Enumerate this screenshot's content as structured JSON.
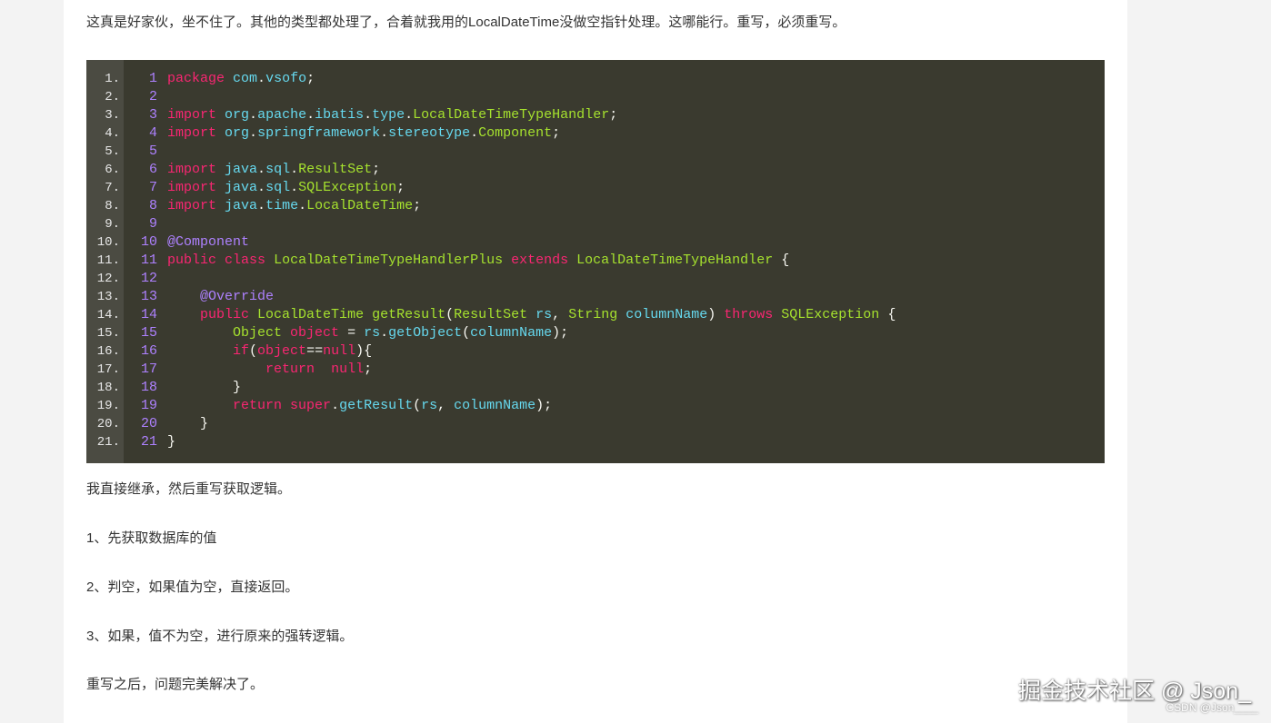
{
  "article": {
    "intro": "这真是好家伙，坐不住了。其他的类型都处理了，合着就我用的LocalDateTime没做空指针处理。这哪能行。重写，必须重写。",
    "after_code": "我直接继承，然后重写获取逻辑。",
    "step1": "1、先获取数据库的值",
    "step2": "2、判空，如果值为空，直接返回。",
    "step3": "3、如果，值不为空，进行原来的强转逻辑。",
    "conclusion": "重写之后，问题完美解决了。"
  },
  "code": {
    "gutter": [
      "1.",
      "2.",
      "3.",
      "4.",
      "5.",
      "6.",
      "7.",
      "8.",
      "9.",
      "10.",
      "11.",
      "12.",
      "13.",
      "14.",
      "15.",
      "16.",
      "17.",
      "18.",
      "19.",
      "20.",
      "21."
    ],
    "lines": [
      [
        {
          "t": "1",
          "c": "ln"
        },
        {
          "t": "package",
          "c": "kw"
        },
        {
          "t": " ",
          "c": "pl"
        },
        {
          "t": "com",
          "c": "pkg"
        },
        {
          "t": ".",
          "c": "pl"
        },
        {
          "t": "vsofo",
          "c": "pkg"
        },
        {
          "t": ";",
          "c": "pl"
        }
      ],
      [
        {
          "t": "2",
          "c": "ln"
        }
      ],
      [
        {
          "t": "3",
          "c": "ln"
        },
        {
          "t": "import",
          "c": "kw"
        },
        {
          "t": " ",
          "c": "pl"
        },
        {
          "t": "org",
          "c": "pkg"
        },
        {
          "t": ".",
          "c": "pl"
        },
        {
          "t": "apache",
          "c": "pkg"
        },
        {
          "t": ".",
          "c": "pl"
        },
        {
          "t": "ibatis",
          "c": "pkg"
        },
        {
          "t": ".",
          "c": "pl"
        },
        {
          "t": "type",
          "c": "pkg"
        },
        {
          "t": ".",
          "c": "pl"
        },
        {
          "t": "LocalDateTimeTypeHandler",
          "c": "cls"
        },
        {
          "t": ";",
          "c": "pl"
        }
      ],
      [
        {
          "t": "4",
          "c": "ln"
        },
        {
          "t": "import",
          "c": "kw"
        },
        {
          "t": " ",
          "c": "pl"
        },
        {
          "t": "org",
          "c": "pkg"
        },
        {
          "t": ".",
          "c": "pl"
        },
        {
          "t": "springframework",
          "c": "pkg"
        },
        {
          "t": ".",
          "c": "pl"
        },
        {
          "t": "stereotype",
          "c": "pkg"
        },
        {
          "t": ".",
          "c": "pl"
        },
        {
          "t": "Component",
          "c": "cls"
        },
        {
          "t": ";",
          "c": "pl"
        }
      ],
      [
        {
          "t": "5",
          "c": "ln"
        }
      ],
      [
        {
          "t": "6",
          "c": "ln"
        },
        {
          "t": "import",
          "c": "kw"
        },
        {
          "t": " ",
          "c": "pl"
        },
        {
          "t": "java",
          "c": "pkg"
        },
        {
          "t": ".",
          "c": "pl"
        },
        {
          "t": "sql",
          "c": "pkg"
        },
        {
          "t": ".",
          "c": "pl"
        },
        {
          "t": "ResultSet",
          "c": "cls"
        },
        {
          "t": ";",
          "c": "pl"
        }
      ],
      [
        {
          "t": "7",
          "c": "ln"
        },
        {
          "t": "import",
          "c": "kw"
        },
        {
          "t": " ",
          "c": "pl"
        },
        {
          "t": "java",
          "c": "pkg"
        },
        {
          "t": ".",
          "c": "pl"
        },
        {
          "t": "sql",
          "c": "pkg"
        },
        {
          "t": ".",
          "c": "pl"
        },
        {
          "t": "SQLException",
          "c": "cls"
        },
        {
          "t": ";",
          "c": "pl"
        }
      ],
      [
        {
          "t": "8",
          "c": "ln"
        },
        {
          "t": "import",
          "c": "kw"
        },
        {
          "t": " ",
          "c": "pl"
        },
        {
          "t": "java",
          "c": "pkg"
        },
        {
          "t": ".",
          "c": "pl"
        },
        {
          "t": "time",
          "c": "pkg"
        },
        {
          "t": ".",
          "c": "pl"
        },
        {
          "t": "LocalDateTime",
          "c": "cls"
        },
        {
          "t": ";",
          "c": "pl"
        }
      ],
      [
        {
          "t": "9",
          "c": "ln"
        }
      ],
      [
        {
          "t": "10",
          "c": "ln"
        },
        {
          "t": "@Component",
          "c": "ann"
        }
      ],
      [
        {
          "t": "11",
          "c": "ln"
        },
        {
          "t": "public",
          "c": "kw"
        },
        {
          "t": " ",
          "c": "pl"
        },
        {
          "t": "class",
          "c": "kw"
        },
        {
          "t": " ",
          "c": "pl"
        },
        {
          "t": "LocalDateTimeTypeHandlerPlus",
          "c": "cls"
        },
        {
          "t": " ",
          "c": "pl"
        },
        {
          "t": "extends",
          "c": "kw"
        },
        {
          "t": " ",
          "c": "pl"
        },
        {
          "t": "LocalDateTimeTypeHandler",
          "c": "cls"
        },
        {
          "t": " {",
          "c": "pl"
        }
      ],
      [
        {
          "t": "12",
          "c": "ln"
        }
      ],
      [
        {
          "t": "13",
          "c": "ln"
        },
        {
          "t": "    ",
          "c": "pl"
        },
        {
          "t": "@Override",
          "c": "ann"
        }
      ],
      [
        {
          "t": "14",
          "c": "ln"
        },
        {
          "t": "    ",
          "c": "pl"
        },
        {
          "t": "public",
          "c": "kw"
        },
        {
          "t": " ",
          "c": "pl"
        },
        {
          "t": "LocalDateTime",
          "c": "cls"
        },
        {
          "t": " ",
          "c": "pl"
        },
        {
          "t": "getResult",
          "c": "cls"
        },
        {
          "t": "(",
          "c": "pl"
        },
        {
          "t": "ResultSet",
          "c": "cls"
        },
        {
          "t": " ",
          "c": "pl"
        },
        {
          "t": "rs",
          "c": "pkg"
        },
        {
          "t": ", ",
          "c": "pl"
        },
        {
          "t": "String",
          "c": "cls"
        },
        {
          "t": " ",
          "c": "pl"
        },
        {
          "t": "columnName",
          "c": "pkg"
        },
        {
          "t": ") ",
          "c": "pl"
        },
        {
          "t": "throws",
          "c": "kw"
        },
        {
          "t": " ",
          "c": "pl"
        },
        {
          "t": "SQLException",
          "c": "cls"
        },
        {
          "t": " {",
          "c": "pl"
        }
      ],
      [
        {
          "t": "15",
          "c": "ln"
        },
        {
          "t": "        ",
          "c": "pl"
        },
        {
          "t": "Object",
          "c": "cls"
        },
        {
          "t": " ",
          "c": "pl"
        },
        {
          "t": "object",
          "c": "kw"
        },
        {
          "t": " = ",
          "c": "pl"
        },
        {
          "t": "rs",
          "c": "pkg"
        },
        {
          "t": ".",
          "c": "pl"
        },
        {
          "t": "getObject",
          "c": "pkg"
        },
        {
          "t": "(",
          "c": "pl"
        },
        {
          "t": "columnName",
          "c": "pkg"
        },
        {
          "t": ");",
          "c": "pl"
        }
      ],
      [
        {
          "t": "16",
          "c": "ln"
        },
        {
          "t": "        ",
          "c": "pl"
        },
        {
          "t": "if",
          "c": "kw"
        },
        {
          "t": "(",
          "c": "pl"
        },
        {
          "t": "object",
          "c": "kw"
        },
        {
          "t": "==",
          "c": "pl"
        },
        {
          "t": "null",
          "c": "kw"
        },
        {
          "t": "){",
          "c": "pl"
        }
      ],
      [
        {
          "t": "17",
          "c": "ln"
        },
        {
          "t": "            ",
          "c": "pl"
        },
        {
          "t": "return",
          "c": "kw"
        },
        {
          "t": "  ",
          "c": "pl"
        },
        {
          "t": "null",
          "c": "kw"
        },
        {
          "t": ";",
          "c": "pl"
        }
      ],
      [
        {
          "t": "18",
          "c": "ln"
        },
        {
          "t": "        }",
          "c": "pl"
        }
      ],
      [
        {
          "t": "19",
          "c": "ln"
        },
        {
          "t": "        ",
          "c": "pl"
        },
        {
          "t": "return",
          "c": "kw"
        },
        {
          "t": " ",
          "c": "pl"
        },
        {
          "t": "super",
          "c": "kw"
        },
        {
          "t": ".",
          "c": "pl"
        },
        {
          "t": "getResult",
          "c": "pkg"
        },
        {
          "t": "(",
          "c": "pl"
        },
        {
          "t": "rs",
          "c": "pkg"
        },
        {
          "t": ", ",
          "c": "pl"
        },
        {
          "t": "columnName",
          "c": "pkg"
        },
        {
          "t": ");",
          "c": "pl"
        }
      ],
      [
        {
          "t": "20",
          "c": "ln"
        },
        {
          "t": "    }",
          "c": "pl"
        }
      ],
      [
        {
          "t": "21",
          "c": "ln"
        },
        {
          "t": "}",
          "c": "pl"
        }
      ]
    ]
  },
  "watermark": {
    "main": "掘金技术社区 @ Json_",
    "sub": "CSDN @Json____"
  }
}
